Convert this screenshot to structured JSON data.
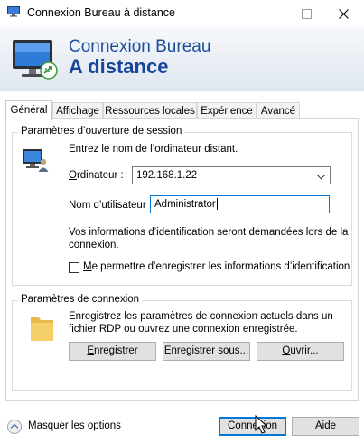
{
  "window": {
    "title": "Connexion Bureau à distance",
    "minimize_icon": "minimize-icon",
    "maximize_icon": "maximize-icon",
    "close_icon": "close-icon"
  },
  "banner": {
    "line1": "Connexion Bureau",
    "line2": "A distance",
    "icon": "remote-desktop-monitor-icon"
  },
  "tabs": [
    {
      "label": "Général",
      "active": true
    },
    {
      "label": "Affichage",
      "active": false
    },
    {
      "label": "Ressources locales",
      "active": false
    },
    {
      "label": "Expérience",
      "active": false
    },
    {
      "label": "Avancé",
      "active": false
    }
  ],
  "logon": {
    "group_title": "Paramètres d’ouverture de session",
    "instruction": "Entrez le nom de l’ordinateur distant.",
    "computer_label": "Ordinateur :",
    "computer_value": "192.168.1.22",
    "username_label": "Nom d’utilisateur :",
    "username_value": "Administrator",
    "info_line1": "Vos informations d’identification seront demandées lors de la",
    "info_line2": "connexion.",
    "remember_label": "Me permettre d’enregistrer les informations d’identification",
    "remember_checked": false
  },
  "connection": {
    "group_title": "Paramètres de connexion",
    "desc_line1": "Enregistrez les paramètres de connexion actuels dans un",
    "desc_line2": "fichier RDP ou ouvrez une connexion enregistrée.",
    "save_label": "Enregistrer",
    "save_as_label": "Enregistrer sous...",
    "open_label": "Ouvrir..."
  },
  "footer": {
    "hide_options_label": "Masquer les options",
    "connect_label": "Connexion",
    "help_label": "Aide"
  },
  "colors": {
    "banner_text": "#1d4e9a",
    "focus_border": "#0078d7",
    "button_face": "#e1e1e1"
  }
}
